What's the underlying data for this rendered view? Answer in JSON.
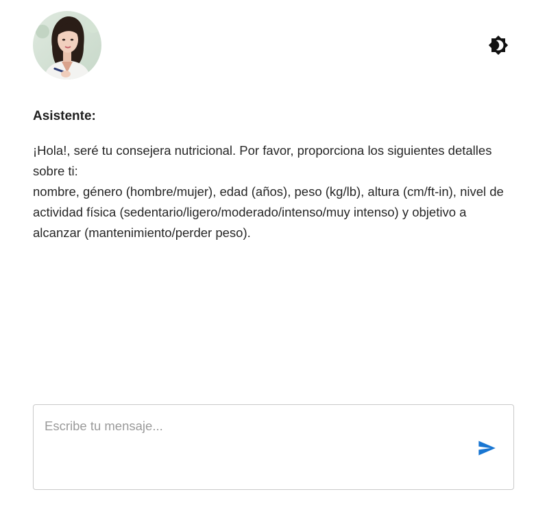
{
  "header": {
    "avatar_icon": "assistant-avatar-photo",
    "theme_toggle_icon": "brightness-icon"
  },
  "chat": {
    "speaker_label": "Asistente:",
    "message_lines": [
      "¡Hola!, seré tu consejera nutricional. Por favor, proporciona los siguientes detalles sobre ti:",
      "nombre, género (hombre/mujer), edad (años), peso (kg/lb), altura (cm/ft-in), nivel de actividad física (sedentario/ligero/moderado/intenso/muy intenso) y objetivo a alcanzar (mantenimiento/perder peso)."
    ]
  },
  "composer": {
    "placeholder": "Escribe tu mensaje...",
    "value": "",
    "send_icon": "send-icon"
  },
  "colors": {
    "accent": "#1976d2",
    "text": "#262626",
    "placeholder": "#9a9a9a",
    "border": "#c9c9c9"
  }
}
